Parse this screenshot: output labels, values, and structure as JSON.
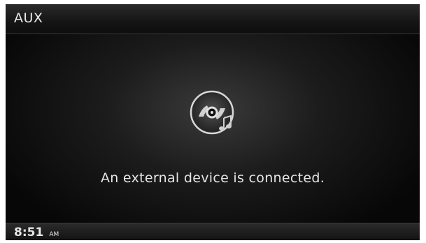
{
  "header": {
    "title": "AUX"
  },
  "main": {
    "icon": "disc-with-music-note-icon",
    "message": "An external device is connected."
  },
  "status_bar": {
    "time": "8:51",
    "ampm": "AM"
  },
  "colors": {
    "background": "#050505",
    "text": "#e6e6e6",
    "bar": "#1c1c1c"
  }
}
